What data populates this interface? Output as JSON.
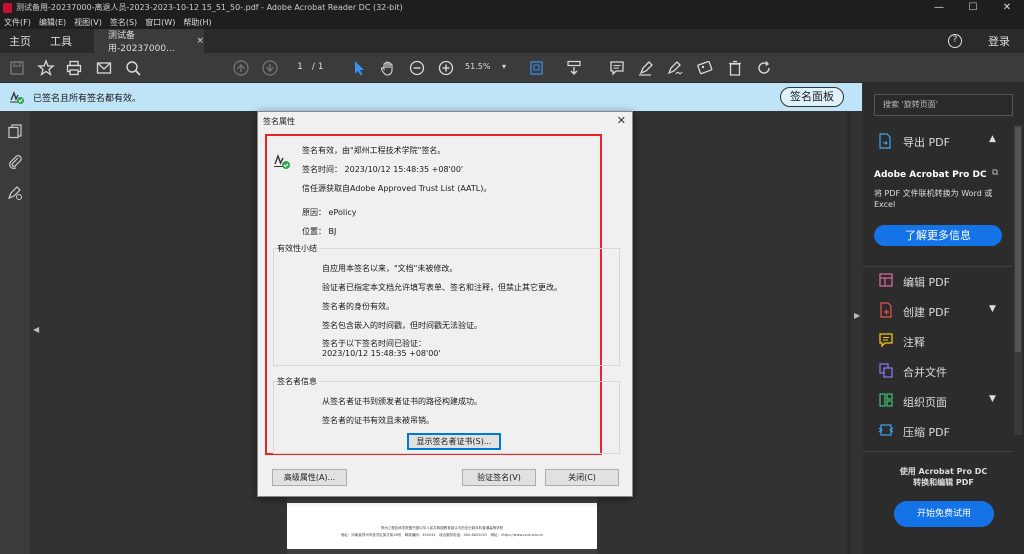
{
  "window": {
    "title": "测试备用-20237000-离退人员-2023-2023-10-12 15_51_50-.pdf - Adobe Acrobat Reader DC (32-bit)",
    "min": "—",
    "max": "☐",
    "close": "✕"
  },
  "menu": [
    "文件(F)",
    "编辑(E)",
    "视图(V)",
    "签名(S)",
    "窗口(W)",
    "帮助(H)"
  ],
  "tabs": {
    "home": "主页",
    "tools": "工具",
    "document": "测试备用-20237000...",
    "close": "×"
  },
  "header": {
    "help": "?",
    "login": "登录"
  },
  "toolbar": {
    "page_current": "1",
    "page_total": "/ 1",
    "zoom": "51.5%",
    "zoom_arrow": "▾"
  },
  "banner": {
    "text": "已签名且所有签名都有效。",
    "panel_button": "签名面板"
  },
  "document": {
    "footer_line1": "郑州工程技术学院图书馆中华人民共和国教育部认可的全日制本科普通高等学校",
    "footer_line2": "地址：河南省郑州市惠济区英才街18号　邮政编码：450044　综合服务电话：400-6822003　网址：https://www.zzut.edu.cn"
  },
  "dialog": {
    "title": "签名属性",
    "close": "✕",
    "summary": {
      "valid": "签名有效，由\"郑州工程技术学院\"签名。",
      "time": "签名时间：  2023/10/12 15:48:35 +08'00'",
      "trust": "信任源获取自Adobe Approved Trust List (AATL)。",
      "reason": "原因：  ePolicy",
      "location": "位置：  BJ"
    },
    "validity_group": {
      "label": "有效性小结",
      "lines": [
        "自应用本签名以来，\"文档\"未被修改。",
        "验证者已指定本文档允许填写表单、签名和注释，但禁止其它更改。",
        "签名者的身份有效。",
        "签名包含嵌入的时间戳，但时间戳无法验证。",
        "签名于以下签名时间已验证：",
        "2023/10/12 15:48:35 +08'00'"
      ]
    },
    "signer_group": {
      "label": "签名者信息",
      "lines": [
        "从签名者证书到颁发者证书的路径构建成功。",
        "签名者的证书有效且未被吊销。"
      ],
      "show_cert_button": "显示签名者证书(S)..."
    },
    "buttons": {
      "advanced": "高级属性(A)...",
      "validate": "验证签名(V)",
      "close": "关闭(C)"
    }
  },
  "right_panel": {
    "search_placeholder": "搜索 '旋转页面'",
    "export_pdf": "导出 PDF",
    "promo": {
      "product": "Adobe Acrobat Pro DC",
      "description": "将 PDF 文件联机转换为 Word 或 Excel",
      "learn_more": "了解更多信息"
    },
    "tools": [
      "编辑 PDF",
      "创建 PDF",
      "注释",
      "合并文件",
      "组织页面",
      "压缩 PDF"
    ],
    "bottom_text": "使用 Acrobat Pro DC 转换和编辑 PDF",
    "trial_button": "开始免费试用"
  },
  "colors": {
    "accent": "#1473e6",
    "banner": "#bfe3f7",
    "red_frame": "#e8262a",
    "export_icon": "#3ba8ec"
  },
  "icons": {
    "toolbar": [
      "save-icon",
      "star-icon",
      "print-icon",
      "email-icon",
      "search-icon",
      "page-up-icon",
      "page-down-icon",
      "select-cursor-icon",
      "hand-icon",
      "zoom-out-icon",
      "zoom-in-icon",
      "fit-page-icon",
      "scroll-mode-icon",
      "comment-icon",
      "highlight-icon",
      "sign-icon",
      "stamp-icon",
      "delete-icon",
      "rotate-icon"
    ],
    "left_rail": [
      "pages-icon",
      "attachment-icon",
      "signature-panel-icon"
    ]
  }
}
